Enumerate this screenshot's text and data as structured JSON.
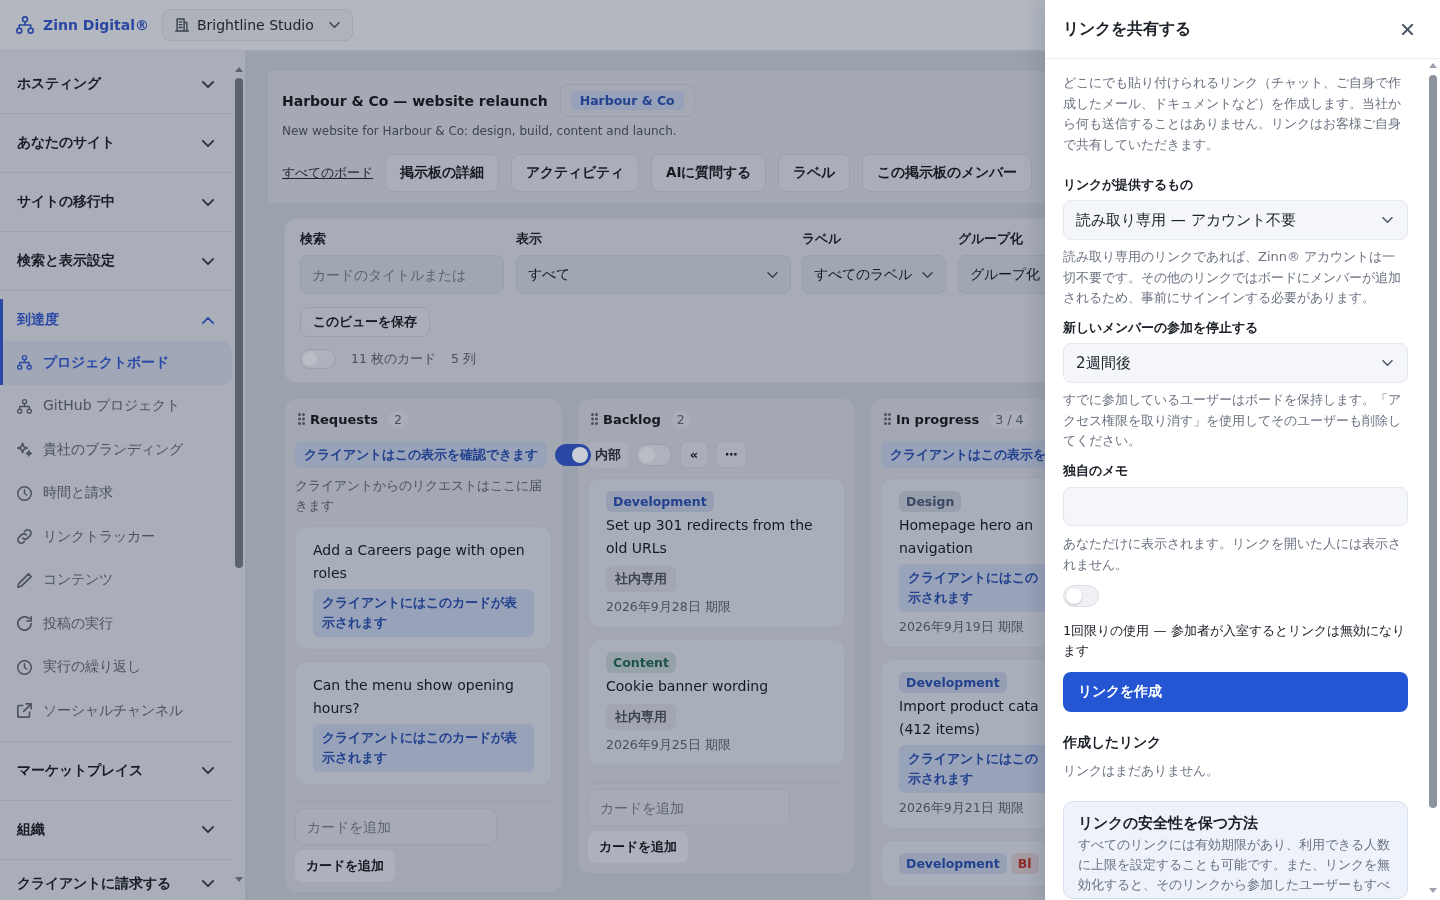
{
  "top_bar": {
    "logo": "Zinn Digital®",
    "workspace": "Brightline Studio"
  },
  "sidebar": {
    "sections": [
      {
        "label": "ホスティング",
        "expanded": false
      },
      {
        "label": "あなたのサイト",
        "expanded": false
      },
      {
        "label": "サイトの移行中",
        "expanded": false
      },
      {
        "label": "検索と表示設定",
        "expanded": false
      },
      {
        "label": "到達度",
        "expanded": true,
        "children": [
          {
            "label": "プロジェクトボード",
            "selected": true
          },
          {
            "label": "GitHub プロジェクト",
            "selected": false
          },
          {
            "label": "貴社のブランディング",
            "selected": false
          },
          {
            "label": "時間と請求",
            "selected": false
          },
          {
            "label": "リンクトラッカー",
            "selected": false
          },
          {
            "label": "コンテンツ",
            "selected": false
          },
          {
            "label": "投稿の実行",
            "selected": false
          },
          {
            "label": "実行の繰り返し",
            "selected": false
          },
          {
            "label": "ソーシャルチャンネル",
            "selected": false
          }
        ]
      },
      {
        "label": "マーケットプレイス",
        "expanded": false
      },
      {
        "label": "組織",
        "expanded": false
      },
      {
        "label": "クライアントに請求する",
        "expanded": false
      }
    ]
  },
  "board": {
    "title": "Harbour & Co — website relaunch",
    "client": "Harbour & Co",
    "description": "New website for Harbour & Co: design, build, content and launch.",
    "back_link": "すべてのボード",
    "actions": [
      "掲示板の詳細",
      "アクティビティ",
      "AIに質問する",
      "ラベル",
      "この掲示板のメンバー"
    ]
  },
  "filters": {
    "fields": [
      {
        "label": "検索",
        "kind": "search",
        "placeholder": "カードのタイトルまたは"
      },
      {
        "label": "表示",
        "kind": "select",
        "value": "すべて"
      },
      {
        "label": "ラベル",
        "kind": "select",
        "value": "すべてのラベル"
      },
      {
        "label": "グループ化",
        "kind": "field",
        "value": "グループ化"
      }
    ],
    "save_button": "このビューを保存",
    "toggle": {
      "on": false
    },
    "card_count": "11 枚のカード",
    "column_count": "5 列"
  },
  "columns": [
    {
      "title": "Requests",
      "count": "2",
      "chip": {
        "text": "クライアントはこの表示を確認できます",
        "kind": "client"
      },
      "toggle": {
        "on": true
      },
      "description": "クライアントからのリクエストはここに届きます",
      "cards": [
        {
          "title": "Add a Careers page with open roles",
          "note": {
            "text": "クライアントにはこのカードが表示されます",
            "kind": "client"
          }
        },
        {
          "title": "Can the menu show opening hours?",
          "note": {
            "text": "クライアントにはこのカードが表示されます",
            "kind": "client"
          }
        }
      ],
      "add_placeholder": "カードを追加",
      "add_button": "カードを追加"
    },
    {
      "title": "Backlog",
      "count": "2",
      "chip": {
        "text": "内部",
        "kind": "internal"
      },
      "toggle": {
        "on": false
      },
      "buttons": [
        "«",
        "⋯"
      ],
      "cards": [
        {
          "tags": [
            {
              "label": "Development",
              "color": "#22418f"
            }
          ],
          "title": "Set up 301 redirects from the old URLs",
          "note": {
            "text": "社内専用",
            "kind": "internal"
          },
          "due": "2026年9月28日 期限"
        },
        {
          "tags": [
            {
              "label": "Content",
              "color": "#1d5247"
            }
          ],
          "title": "Cookie banner wording",
          "note": {
            "text": "社内専用",
            "kind": "internal"
          },
          "due": "2026年9月25日 期限"
        }
      ],
      "add_placeholder": "カードを追加",
      "add_button": "カードを追加"
    },
    {
      "title": "In progress",
      "count": "3 / 4",
      "chip": {
        "text": "クライアントはこの表示を",
        "kind": "client"
      },
      "cards": [
        {
          "tags": [
            {
              "label": "Design",
              "color": "#3b4861"
            }
          ],
          "title": "Homepage hero an navigation",
          "note": {
            "text": "クライアントにはこの示されます",
            "kind": "client"
          },
          "due": "2026年9月19日 期限"
        },
        {
          "tags": [
            {
              "label": "Development",
              "color": "#22418f"
            }
          ],
          "title": "Import product cata (412 items)",
          "note": {
            "text": "クライアントにはこの示されます",
            "kind": "client"
          },
          "due": "2026年9月21日 期限"
        },
        {
          "tags": [
            {
              "label": "Development",
              "color": "#22418f"
            },
            {
              "label": "Bl",
              "color": "#8f2a2a"
            }
          ]
        }
      ]
    }
  ],
  "share_panel": {
    "title": "リンクを共有する",
    "intro": "どこにでも貼り付けられるリンク（チャット、ご自身で作成したメール、ドキュメントなど）を作成します。当社から何も送信することはありません。リンクはお客様ご自身で共有していただきます。",
    "fields": [
      {
        "label": "リンクが提供するもの",
        "kind": "select",
        "value": "読み取り専用 — アカウント不要",
        "help": "読み取り専用のリンクであれば、Zinn® アカウントは一切不要です。その他のリンクではボードにメンバーが追加されるため、事前にサインインする必要があります。"
      },
      {
        "label": "新しいメンバーの参加を停止する",
        "kind": "select",
        "value": "2週間後",
        "help": "すでに参加しているユーザーはボードを保持します。「アクセス権限を取り消す」を使用してそのユーザーも削除してください。"
      },
      {
        "label": "独自のメモ",
        "kind": "text",
        "help": "あなただけに表示されます。リンクを開いた人には表示されません。"
      }
    ],
    "single_use": {
      "on": false,
      "label": "1回限りの使用 — 参加者が入室するとリンクは無効になります"
    },
    "create_button": "リンクを作成",
    "links_heading": "作成したリンク",
    "empty_text": "リンクはまだありません。",
    "tip": {
      "title": "リンクの安全性を保つ方法",
      "text": "すべてのリンクには有効期限があり、利用できる人数に上限を設定することも可能です。また、リンクを無効化すると、そのリンクから参加したユーザーもすべ"
    }
  }
}
